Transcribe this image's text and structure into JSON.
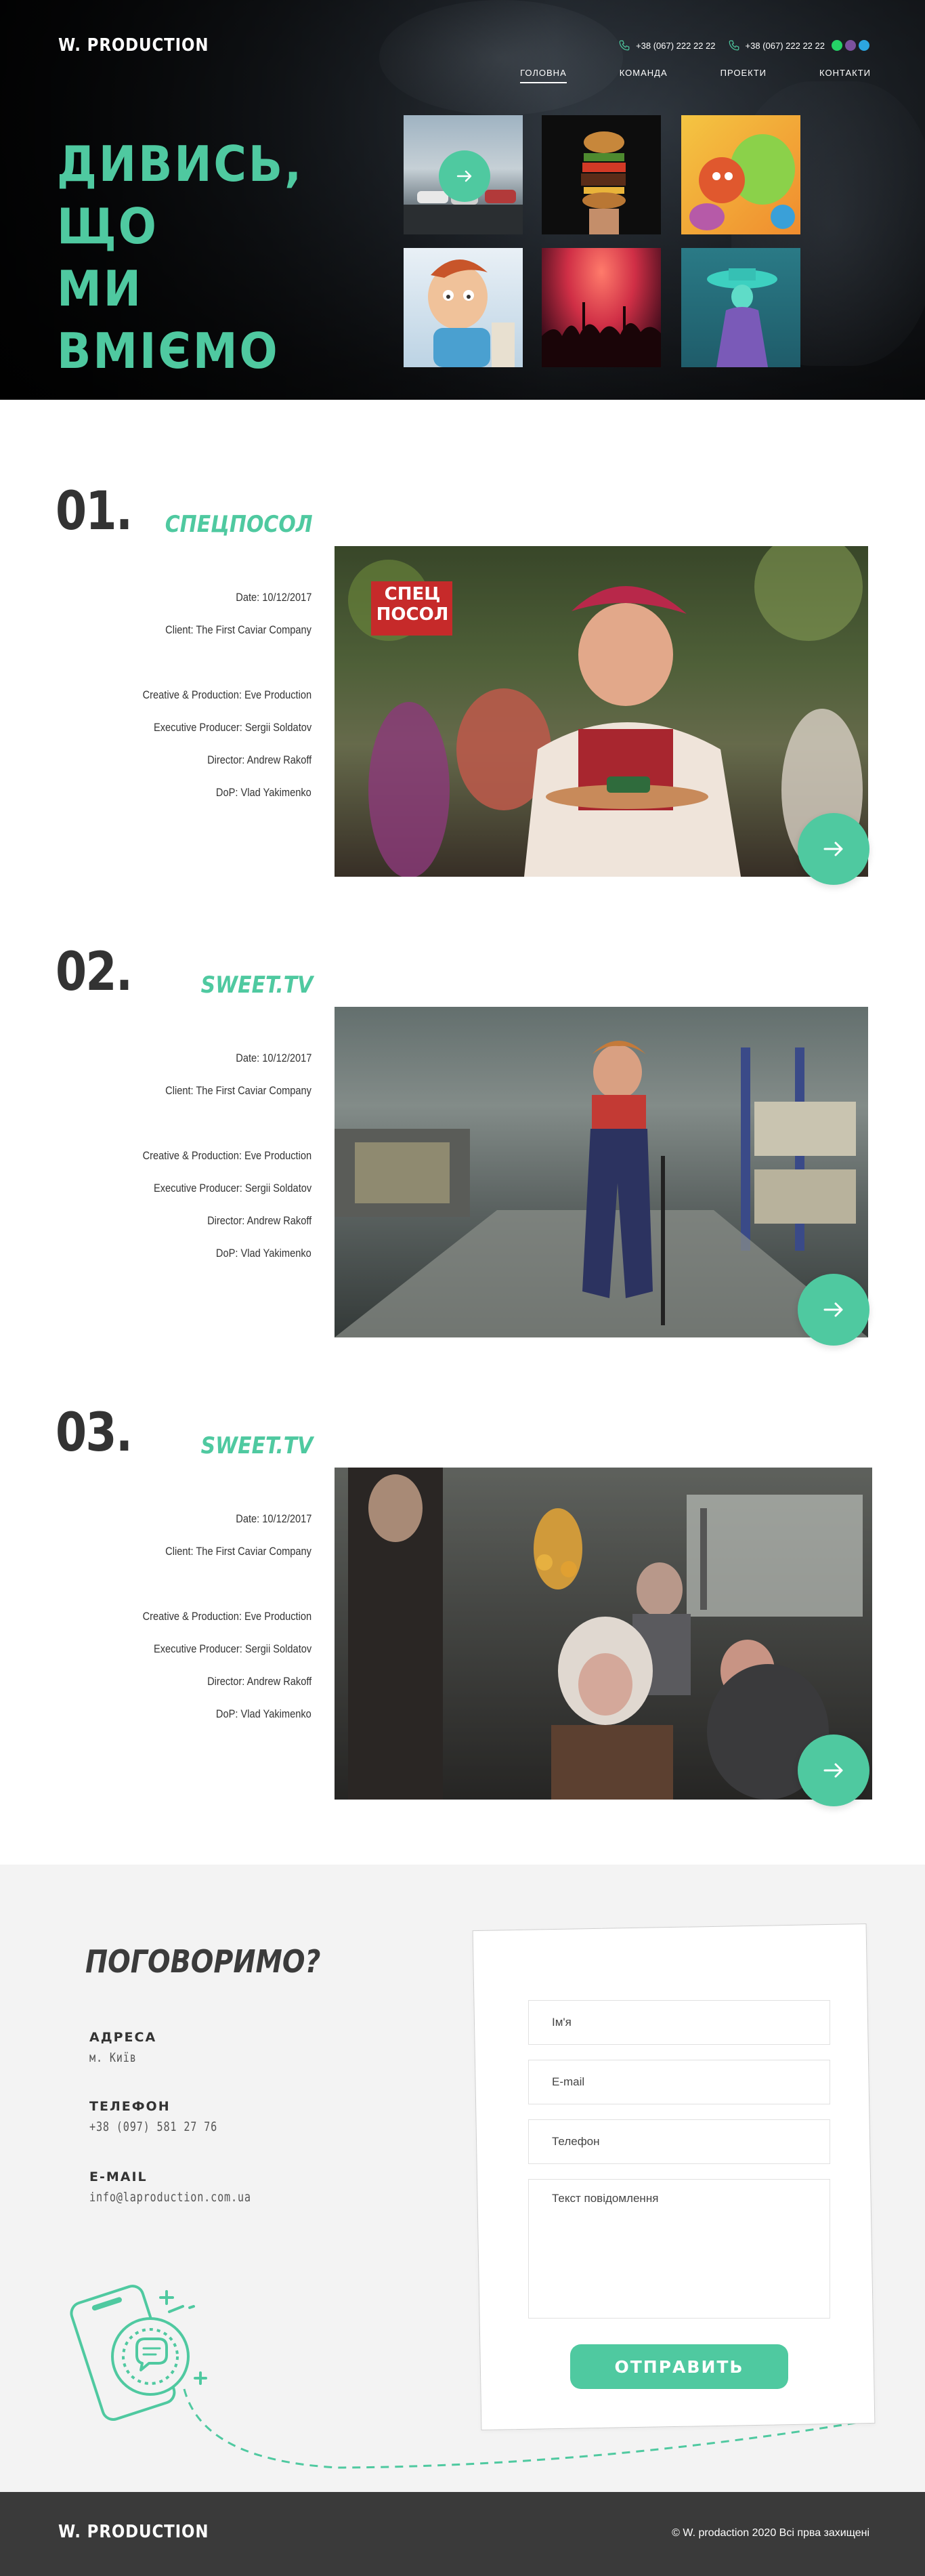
{
  "brand": {
    "logo": "W. PRODUCTION"
  },
  "header": {
    "phones": [
      "+38 (067) 222 22 22",
      "+38 (067) 222 22 22"
    ],
    "messengers": [
      "whatsapp-icon",
      "viber-icon",
      "telegram-icon"
    ],
    "nav": [
      {
        "label": "ГОЛОВНА",
        "active": true
      },
      {
        "label": "КОМАНДА",
        "active": false
      },
      {
        "label": "ПРОЕКТИ",
        "active": false
      },
      {
        "label": "КОНТАКТИ",
        "active": false
      }
    ]
  },
  "hero": {
    "title_line1": "ДИВИСЬ, ЩО",
    "title_line2": "МИ ВМІЄМО",
    "accent": "#4fc9a0"
  },
  "projects": [
    {
      "number": "01.",
      "name": "СПЕЦПОСОЛ",
      "date": "Date: 10/12/2017",
      "client": "Client: The First Caviar Company",
      "creative": "Creative & Production: Eve Production",
      "executive": "Executive Producer: Sergii Soldatov",
      "director": "Director: Andrew Rakoff",
      "dop": "DoP: Vlad Yakimenko",
      "image_sign_line1": "СПЕЦ",
      "image_sign_line2": "ПОСОЛ"
    },
    {
      "number": "02.",
      "name": "SWEET.TV",
      "date": "Date: 10/12/2017",
      "client": "Client: The First Caviar Company",
      "creative": "Creative & Production: Eve Production",
      "executive": "Executive Producer: Sergii Soldatov",
      "director": "Director: Andrew Rakoff",
      "dop": "DoP: Vlad Yakimenko"
    },
    {
      "number": "03.",
      "name": "SWEET.TV",
      "date": "Date: 10/12/2017",
      "client": "Client: The First Caviar Company",
      "creative": "Creative & Production: Eve Production",
      "executive": "Executive Producer: Sergii Soldatov",
      "director": "Director: Andrew Rakoff",
      "dop": "DoP: Vlad Yakimenko"
    }
  ],
  "contact": {
    "title": "ПОГОВОРИМО?",
    "address_label": "АДРЕСА",
    "address_value": "м. Київ",
    "phone_label": "ТЕЛЕФОН",
    "phone_value": "+38 (097) 581 27 76",
    "email_label": "E-MAIL",
    "email_value": "info@laproduction.com.ua",
    "form": {
      "name_placeholder": "Ім'я",
      "email_placeholder": "E-mail",
      "phone_placeholder": "Телефон",
      "message_placeholder": "Текст повідомлення",
      "submit_label": "ОТПРАВИТЬ"
    }
  },
  "footer": {
    "logo": "W. PRODUCTION",
    "copyright": "© W. prodaction  2020 Всі прва захищені"
  }
}
